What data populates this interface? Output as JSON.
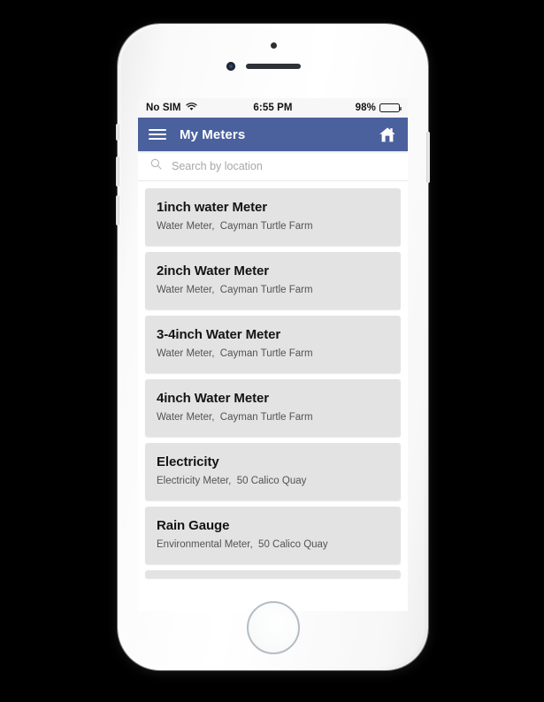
{
  "status_bar": {
    "carrier": "No SIM",
    "wifi_icon": "wifi-icon",
    "time": "6:55 PM",
    "battery_percent": "98%",
    "battery_level": 98
  },
  "app_bar": {
    "menu_icon": "hamburger-menu-icon",
    "title": "My Meters",
    "home_icon": "home-icon",
    "background_color": "#4a619e"
  },
  "search": {
    "icon": "search-icon",
    "placeholder": "Search by location",
    "value": ""
  },
  "meters": [
    {
      "title": "1inch water Meter",
      "subtitle": "Water Meter,  Cayman Turtle Farm"
    },
    {
      "title": "2inch Water Meter",
      "subtitle": "Water Meter,  Cayman Turtle Farm"
    },
    {
      "title": "3-4inch Water Meter",
      "subtitle": "Water Meter,  Cayman Turtle Farm"
    },
    {
      "title": "4inch Water Meter",
      "subtitle": "Water Meter,  Cayman Turtle Farm"
    },
    {
      "title": "Electricity",
      "subtitle": "Electricity Meter,  50 Calico Quay"
    },
    {
      "title": "Rain Gauge",
      "subtitle": "Environmental Meter,  50 Calico Quay"
    }
  ],
  "device": {
    "home_button": "home-button",
    "speaker": "earpiece-speaker",
    "camera": "front-camera",
    "sensor": "proximity-sensor"
  },
  "colors": {
    "accent": "#4a619e",
    "card": "#e3e3e3",
    "screen": "#ffffff",
    "title_text": "#141414",
    "subtitle_text": "#535353"
  }
}
